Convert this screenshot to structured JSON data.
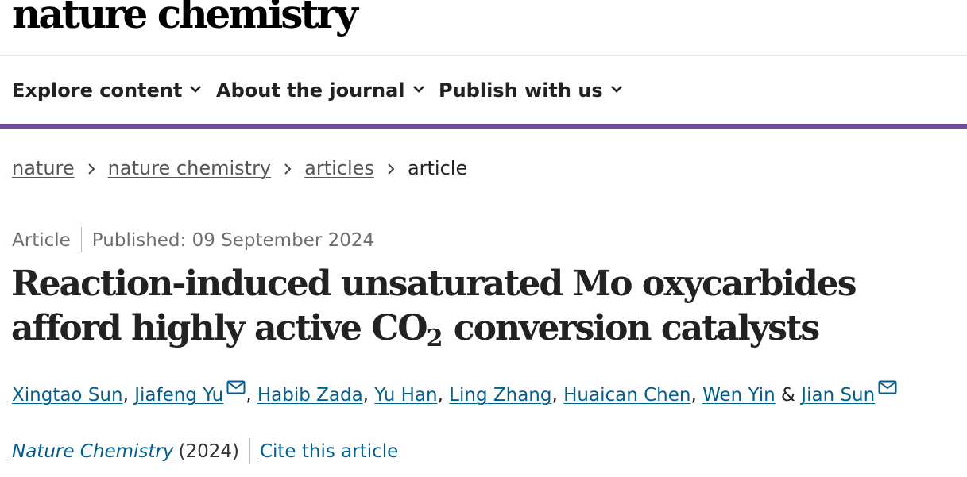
{
  "site": {
    "logo_text": "nature chemistry"
  },
  "nav": {
    "items": [
      {
        "label": "Explore content"
      },
      {
        "label": "About the journal"
      },
      {
        "label": "Publish with us"
      }
    ],
    "accent_color": "#6f4d97"
  },
  "breadcrumb": {
    "items": [
      "nature",
      "nature chemistry",
      "articles"
    ],
    "current": "article"
  },
  "article": {
    "type": "Article",
    "published": "Published: 09 September 2024",
    "title_part1": "Reaction-induced unsaturated Mo oxycarbides afford highly active CO",
    "title_subscript": "2",
    "title_part2": " conversion catalysts",
    "authors": [
      {
        "name": "Xingtao Sun",
        "corresponding": false
      },
      {
        "name": "Jiafeng Yu",
        "corresponding": true
      },
      {
        "name": "Habib Zada",
        "corresponding": false
      },
      {
        "name": "Yu Han",
        "corresponding": false
      },
      {
        "name": "Ling Zhang",
        "corresponding": false
      },
      {
        "name": "Huaican Chen",
        "corresponding": false
      },
      {
        "name": "Wen Yin",
        "corresponding": false
      },
      {
        "name": "Jian Sun",
        "corresponding": true
      }
    ],
    "journal": "Nature Chemistry",
    "year": "(2024)",
    "cite_label": "Cite this article",
    "link_color": "#025e8d"
  }
}
